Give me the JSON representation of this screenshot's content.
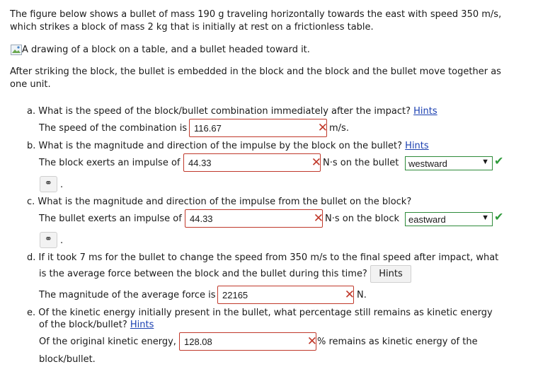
{
  "intro": {
    "line1": "The figure below shows a bullet of mass 190 g traveling horizontally towards the east with speed 350 m/s,",
    "line2": "which strikes a block of mass 2 kg that is initially at rest on a frictionless table.",
    "image_alt": "A drawing of a block on a table, and a bullet headed toward it.",
    "after1": "After striking the block, the bullet is embedded in the block and the block and the bullet move together as",
    "after2": "one unit."
  },
  "qa": {
    "q": "a. What is the speed of the block/bullet combination immediately after the impact?",
    "hints": "Hints",
    "prefix": "The speed of the combination is",
    "value": "116.67",
    "unit": "m/s."
  },
  "qb": {
    "q": "b. What is the magnitude and direction of the impulse by the block on the bullet?",
    "hints": "Hints",
    "prefix": "The block exerts an impulse of",
    "value": "44.33",
    "unit": "N·s on the bullet",
    "direction": "westward"
  },
  "qc": {
    "q": "c. What is the magnitude and direction of the impulse from the bullet on the block?",
    "prefix": "The bullet exerts an impulse of",
    "value": "44.33",
    "unit": "N·s on the block",
    "direction": "eastward"
  },
  "qd": {
    "q1": "d. If it took 7 ms for the bullet to change the speed from 350 m/s to the final speed after impact, what",
    "q2": "is the average force between the block and the bullet during this time?",
    "hints": "Hints",
    "prefix": "The magnitude of the average force is",
    "value": "22165",
    "unit": "N."
  },
  "qe": {
    "q1": "e. Of the kinetic energy initially present in the bullet, what percentage still remains as kinetic energy",
    "q2": "of the block/bullet?",
    "hints": "Hints",
    "prefix": "Of the original kinetic energy,",
    "value": "128.08",
    "suffix1": "% remains as kinetic energy of the",
    "suffix2": "block/bullet."
  },
  "symbols": {
    "wrong": "✕",
    "correct": "✔",
    "key_icon": "key-icon",
    "dot": "."
  },
  "colors": {
    "wrong": "#c0392b",
    "correct": "#2e8b3a",
    "link": "#1a3fb0"
  }
}
